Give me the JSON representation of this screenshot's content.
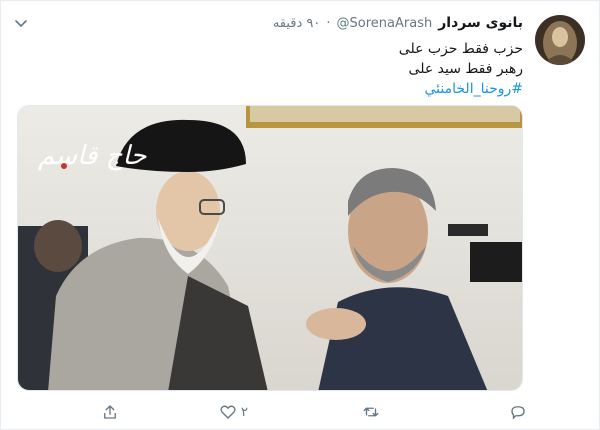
{
  "tweet": {
    "display_name": "بانوی سردار",
    "handle": "@SorenaArash",
    "separator": "·",
    "time": "۹۰ دقیقه",
    "lines": [
      "حزب فقط حزب علی",
      "رهبر فقط سید علی"
    ],
    "hashtag": "#روحنا_الخامنئي",
    "media_watermark": "حاج قاسم",
    "actions": {
      "reply_count": "",
      "retweet_count": "",
      "like_count": "۲",
      "share_count": ""
    }
  },
  "colors": {
    "link": "#1b95e0",
    "muted": "#657786",
    "text": "#14171a"
  },
  "icons": [
    "chevron-down-icon",
    "reply-icon",
    "retweet-icon",
    "like-icon",
    "share-icon"
  ]
}
